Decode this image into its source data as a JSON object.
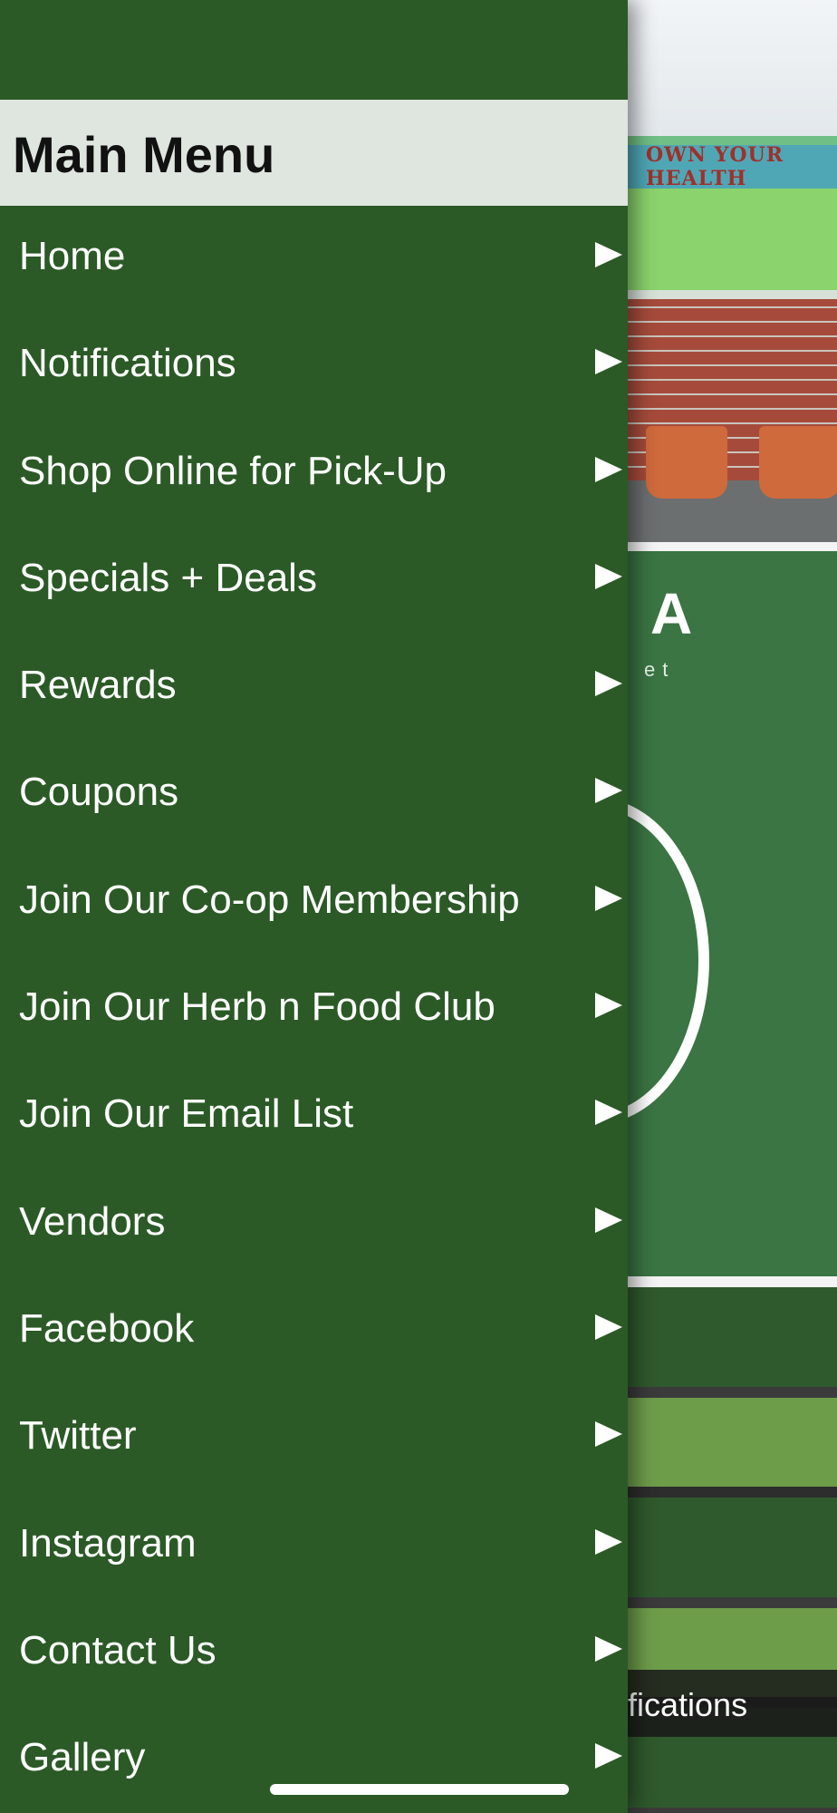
{
  "menu": {
    "title": "Main Menu",
    "items": [
      {
        "label": "Home"
      },
      {
        "label": "Notifications"
      },
      {
        "label": "Shop Online for Pick-Up"
      },
      {
        "label": "Specials + Deals"
      },
      {
        "label": "Rewards"
      },
      {
        "label": "Coupons"
      },
      {
        "label": "Join Our Co-op Membership"
      },
      {
        "label": "Join Our Herb n Food Club"
      },
      {
        "label": "Join Our Email List"
      },
      {
        "label": "Vendors"
      },
      {
        "label": "Facebook"
      },
      {
        "label": "Twitter"
      },
      {
        "label": "Instagram"
      },
      {
        "label": "Contact Us"
      },
      {
        "label": "Gallery"
      }
    ],
    "arrow_icon": "triangle-right-icon"
  },
  "background": {
    "store_sign_text": "OWN YOUR HEALTH",
    "logo_partial": "A",
    "logo_sub_partial": "et",
    "notification_partial": "fications"
  },
  "colors": {
    "drawer_bg": "#2b5a26",
    "header_bg": "#dfe5df",
    "panel_green": "#3a7543"
  }
}
